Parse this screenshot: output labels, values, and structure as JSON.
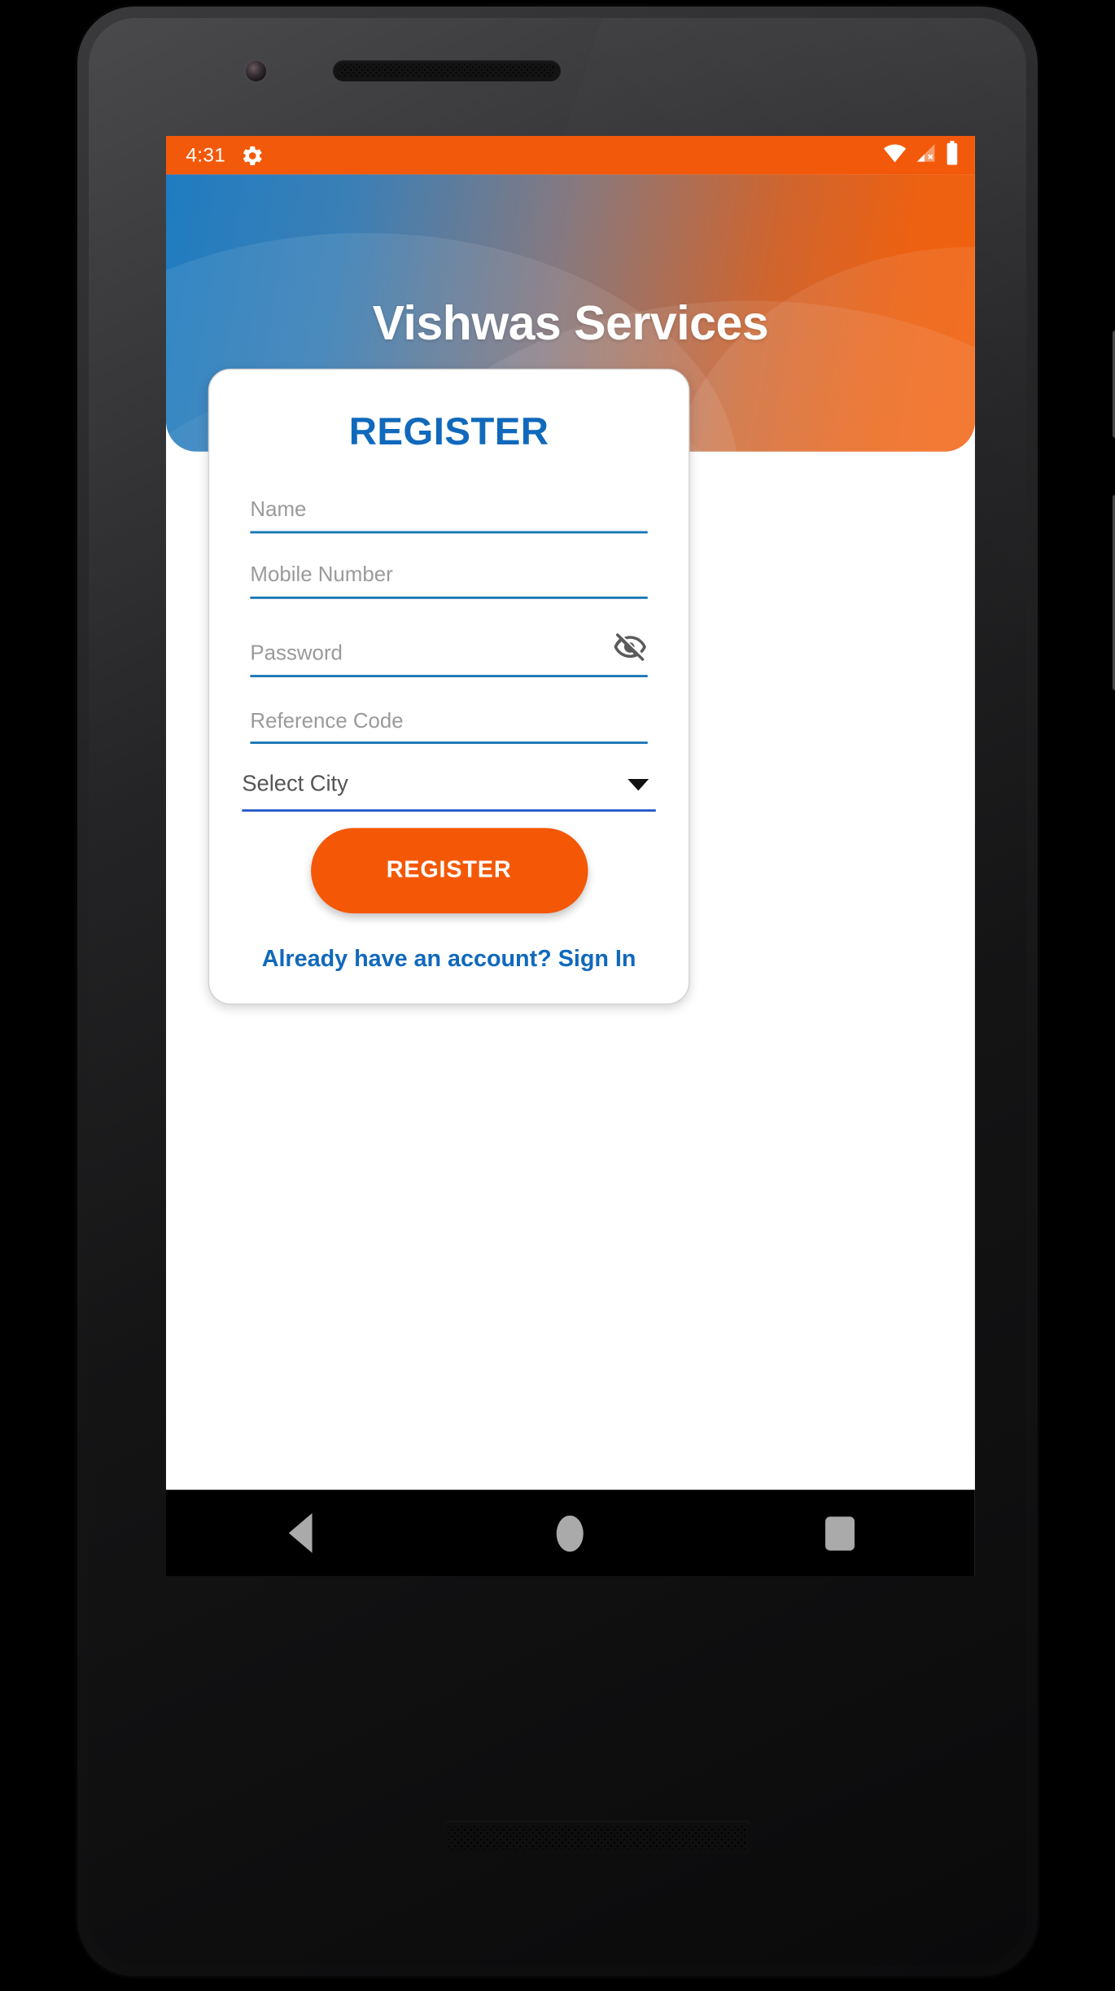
{
  "status_bar": {
    "time": "4:31",
    "gear_icon": "gear-icon",
    "wifi_icon": "wifi-icon",
    "cellular_icon": "cellular-signal-off-icon",
    "battery_icon": "battery-full-icon",
    "background_color": "#F3590A"
  },
  "header": {
    "title": "Vishwas Services",
    "gradient_start": "#1F7CC1",
    "gradient_end": "#F2610D"
  },
  "card": {
    "heading": "REGISTER",
    "heading_color": "#1069BC",
    "fields": [
      {
        "name": "name",
        "placeholder": "Name",
        "value": "",
        "trailing_icon": null
      },
      {
        "name": "mobile",
        "placeholder": "Mobile Number",
        "value": "",
        "trailing_icon": null
      },
      {
        "name": "password",
        "placeholder": "Password",
        "value": "",
        "trailing_icon": "eye-off-icon"
      },
      {
        "name": "reference",
        "placeholder": "Reference Code",
        "value": "",
        "trailing_icon": null
      }
    ],
    "city_spinner": {
      "selected": "Select City",
      "caret_icon": "chevron-down-icon"
    },
    "submit_button": {
      "label": "REGISTER",
      "background_color": "#F45807",
      "text_color": "#FFFFFF"
    },
    "signin_link": {
      "label": "Already have an account? Sign In",
      "color": "#1069BC"
    }
  },
  "nav_bar": {
    "back_icon": "triangle-back-icon",
    "home_icon": "circle-home-icon",
    "recents_icon": "square-recents-icon",
    "icon_color": "#AAAAAA"
  }
}
